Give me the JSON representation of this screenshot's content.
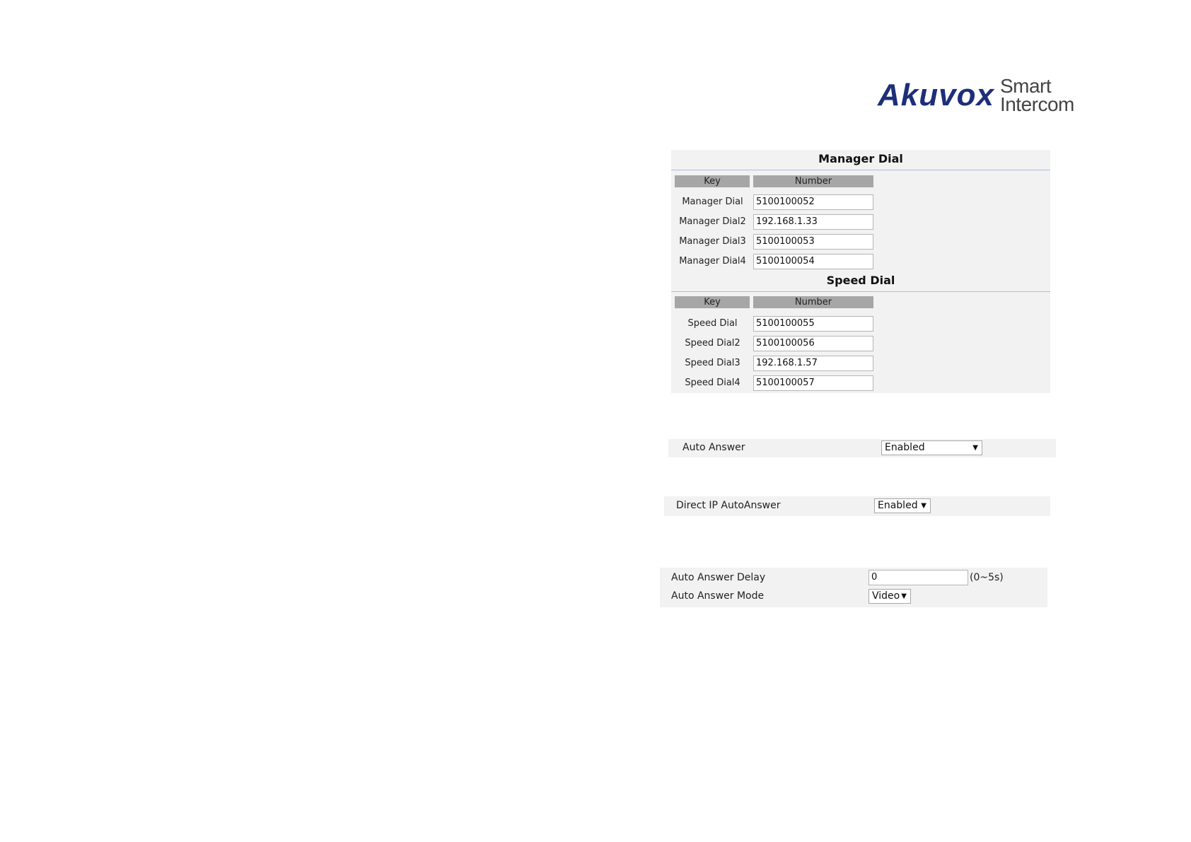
{
  "logo": {
    "brand": "Akuvox",
    "tagline_line1": "Smart",
    "tagline_line2": "Intercom"
  },
  "manager_dial": {
    "title": "Manager Dial",
    "col_key": "Key",
    "col_number": "Number",
    "rows": [
      {
        "key": "Manager Dial",
        "number": "5100100052"
      },
      {
        "key": "Manager Dial2",
        "number": "192.168.1.33"
      },
      {
        "key": "Manager Dial3",
        "number": "5100100053"
      },
      {
        "key": "Manager Dial4",
        "number": "5100100054"
      }
    ]
  },
  "speed_dial": {
    "title": "Speed Dial",
    "col_key": "Key",
    "col_number": "Number",
    "rows": [
      {
        "key": "Speed Dial",
        "number": "5100100055"
      },
      {
        "key": "Speed Dial2",
        "number": "5100100056"
      },
      {
        "key": "Speed Dial3",
        "number": "192.168.1.57"
      },
      {
        "key": "Speed Dial4",
        "number": "5100100057"
      }
    ]
  },
  "auto_answer": {
    "label": "Auto Answer",
    "value": "Enabled"
  },
  "direct_ip": {
    "label": "Direct IP AutoAnswer",
    "value": "Enabled"
  },
  "auto_answer_delay": {
    "label": "Auto Answer Delay",
    "value": "0",
    "range": "(0~5s)"
  },
  "auto_answer_mode": {
    "label": "Auto Answer Mode",
    "value": "Video"
  },
  "colors": {
    "brand": "#1d2f7a",
    "header_gray": "#a6a6a6",
    "panel_bg": "#f2f2f2",
    "divider": "#a9bde0"
  }
}
